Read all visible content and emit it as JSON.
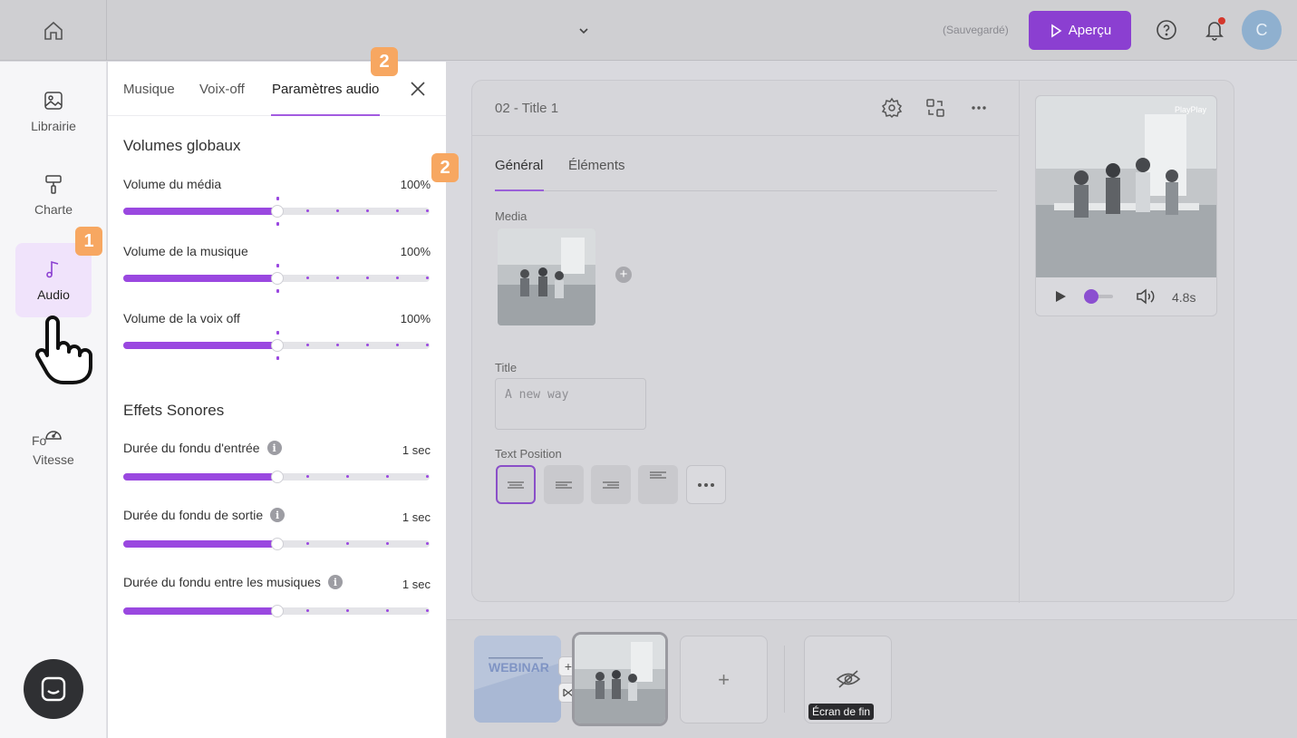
{
  "topbar": {
    "saved_status": "(Sauvegardé)",
    "preview_label": "Aperçu",
    "avatar_initial": "C"
  },
  "leftnav": {
    "items": [
      {
        "label": "Librairie",
        "icon": "image-icon"
      },
      {
        "label": "Charte",
        "icon": "paint-roller-icon"
      },
      {
        "label": "Audio",
        "icon": "music-note-icon",
        "active": true
      },
      {
        "label": "Fo",
        "icon": "font-icon"
      },
      {
        "label": "Vitesse",
        "icon": "speedometer-icon"
      }
    ],
    "step_badge": "1"
  },
  "panel": {
    "tabs": [
      "Musique",
      "Voix-off",
      "Paramètres audio"
    ],
    "active_tab": "Paramètres audio",
    "step_badge_tab": "2",
    "step_badge_section": "2",
    "volumes_title": "Volumes globaux",
    "volumes": [
      {
        "label": "Volume du média",
        "value": "100%",
        "level": 0.5
      },
      {
        "label": "Volume de la musique",
        "value": "100%",
        "level": 0.5
      },
      {
        "label": "Volume de la voix off",
        "value": "100%",
        "level": 0.5
      }
    ],
    "effects_title": "Effets Sonores",
    "effects": [
      {
        "label": "Durée du fondu d'entrée",
        "value": "1 sec",
        "level": 0.5
      },
      {
        "label": "Durée du fondu de sortie",
        "value": "1 sec",
        "level": 0.5
      },
      {
        "label": "Durée du fondu entre les musiques",
        "value": "1 sec",
        "level": 0.5
      }
    ]
  },
  "editor": {
    "slide_title": "02 - Title 1",
    "tabs": [
      "Général",
      "Éléments"
    ],
    "active_tab": "Général",
    "media_label": "Media",
    "title_label": "Title",
    "title_placeholder": "A new way",
    "text_position_label": "Text Position",
    "preview_watermark": "PlayPlay",
    "preview_time": "4.8s"
  },
  "timeline": {
    "slide1_text": "WEBINAR",
    "end_screen_label": "Écran de fin"
  },
  "colors": {
    "accent": "#9a48e0",
    "preview_button": "#8b3fd1",
    "badge": "#f7a761",
    "notification": "#d4372c"
  }
}
